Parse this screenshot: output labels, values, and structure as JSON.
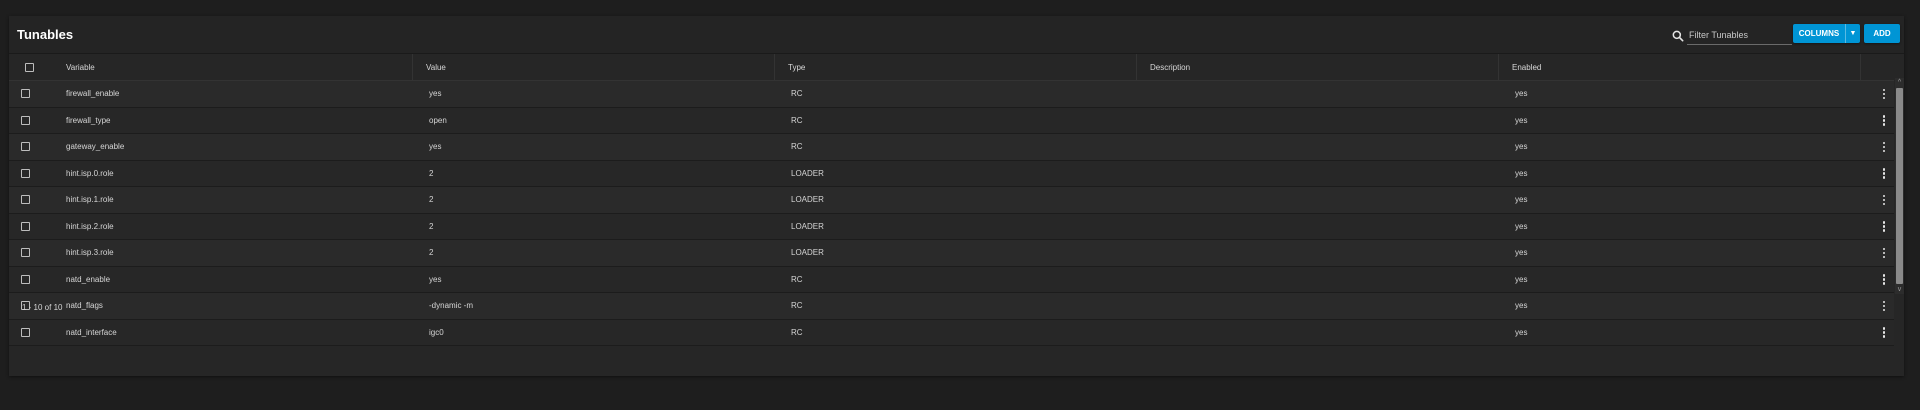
{
  "card": {
    "title": "Tunables"
  },
  "filter": {
    "placeholder": "Filter Tunables",
    "value": ""
  },
  "buttons": {
    "columns": "COLUMNS",
    "add": "ADD"
  },
  "colors": {
    "accent": "#0095d5",
    "background": "#1e1e1e",
    "card": "#262626"
  },
  "table": {
    "headers": {
      "variable": "Variable",
      "value": "Value",
      "type": "Type",
      "description": "Description",
      "enabled": "Enabled"
    },
    "rows": [
      {
        "variable": "firewall_enable",
        "value": "yes",
        "type": "RC",
        "description": "",
        "enabled": "yes"
      },
      {
        "variable": "firewall_type",
        "value": "open",
        "type": "RC",
        "description": "",
        "enabled": "yes"
      },
      {
        "variable": "gateway_enable",
        "value": "yes",
        "type": "RC",
        "description": "",
        "enabled": "yes"
      },
      {
        "variable": "hint.isp.0.role",
        "value": "2",
        "type": "LOADER",
        "description": "",
        "enabled": "yes"
      },
      {
        "variable": "hint.isp.1.role",
        "value": "2",
        "type": "LOADER",
        "description": "",
        "enabled": "yes"
      },
      {
        "variable": "hint.isp.2.role",
        "value": "2",
        "type": "LOADER",
        "description": "",
        "enabled": "yes"
      },
      {
        "variable": "hint.isp.3.role",
        "value": "2",
        "type": "LOADER",
        "description": "",
        "enabled": "yes"
      },
      {
        "variable": "natd_enable",
        "value": "yes",
        "type": "RC",
        "description": "",
        "enabled": "yes"
      },
      {
        "variable": "natd_flags",
        "value": "-dynamic -m",
        "type": "RC",
        "description": "",
        "enabled": "yes"
      },
      {
        "variable": "natd_interface",
        "value": "igc0",
        "type": "RC",
        "description": "",
        "enabled": "yes"
      }
    ]
  },
  "paginator": {
    "range": "1 - 10 of 10"
  },
  "icons": {
    "search": "search-icon",
    "dropdown": "caret-down-icon",
    "row_menu": "more-vert-icon"
  }
}
